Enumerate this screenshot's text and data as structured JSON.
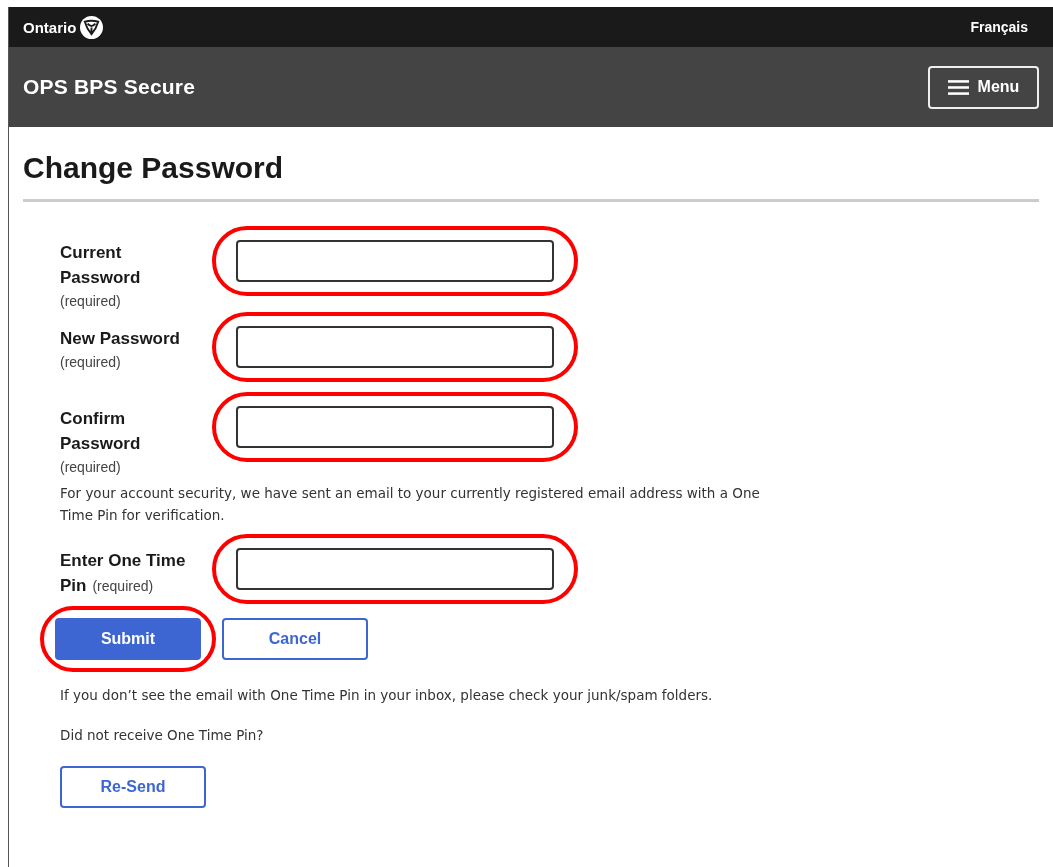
{
  "top_bar": {
    "brand": "Ontario",
    "language_link": "Français"
  },
  "header": {
    "title": "OPS BPS Secure",
    "menu_button": "Menu"
  },
  "page_title": "Change Password",
  "fields": [
    {
      "label": "Current Password",
      "note": "(required)",
      "note_inline": false,
      "highlighted": true
    },
    {
      "label": "New Password",
      "note": "(required)",
      "note_inline": false,
      "highlighted": true
    },
    {
      "label": "Confirm Password",
      "note": "(required)",
      "note_inline": false,
      "highlighted": true
    }
  ],
  "security_message": "For your account security, we have sent an email to your currently registered email address with a One Time Pin for verification.",
  "pin_field": {
    "label": "Enter One Time Pin",
    "note": "(required)",
    "note_inline": true,
    "highlighted": true
  },
  "buttons": [
    {
      "label": "Submit",
      "kind": "primary",
      "highlighted": true
    },
    {
      "label": "Cancel",
      "kind": "secondary",
      "highlighted": false
    }
  ],
  "spam_hint": "If you don’t see the email with One Time Pin in your inbox, please check your junk/spam folders.",
  "resend_prompt": "Did not receive One Time Pin?",
  "resend_button": "Re-Send"
}
